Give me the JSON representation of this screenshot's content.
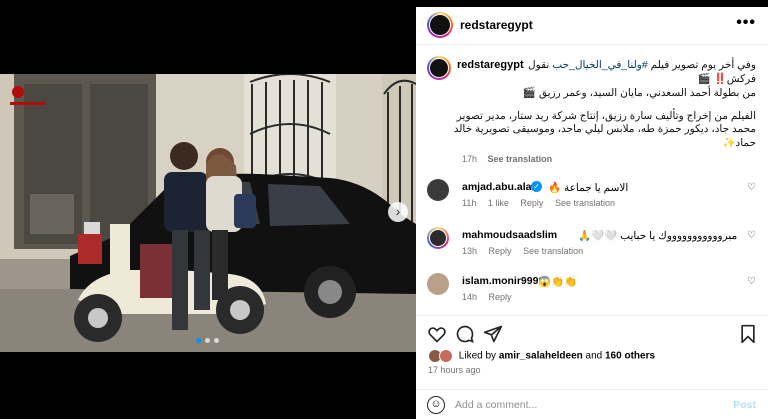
{
  "colors": {
    "accent_link": "#00376b",
    "meta_gray": "#737373",
    "post_disabled": "#b2dffc"
  },
  "post": {
    "username": "redstaregypt",
    "more_icon": "more-horizontal-icon"
  },
  "caption": {
    "username": "redstaregypt",
    "line1_prefix": "وفي أخر يوم تصوير فيلم ",
    "line1_hashtag": "#ولنا_في_الخيال_حب",
    "line1_suffix": " نقول",
    "line2": "فركش‼️ 🎬",
    "line3": "من بطولة أحمد السعدني، مايان السيد، وعمر رزيق 🎬",
    "line4": "الفيلم من إخراج وتأليف سارة رزيق، إنتاج شركة ريد ستار، مدير تصوير",
    "line5": "محمد جاد، ديكور حمزة طه، ملابس ليلي ماجد، وموسيقى تصويرية خالد",
    "line6": "حماد✨",
    "time": "17h",
    "see_translation": "See translation"
  },
  "comments": [
    {
      "user": "amjad.abu.ala",
      "verified": true,
      "text": "الاسم يا جماعة 🔥",
      "time": "11h",
      "likes": "1 like",
      "reply": "Reply",
      "see_translation": "See translation"
    },
    {
      "user": "mahmoudsaadslim",
      "verified": false,
      "text": "مبروووووووووووك يا حبايب 🤍🤍🙏",
      "time": "13h",
      "likes": "",
      "reply": "Reply",
      "see_translation": "See translation"
    },
    {
      "user": "islam.monir9999",
      "verified": false,
      "text": "👏👏😱",
      "time": "14h",
      "likes": "",
      "reply": "Reply",
      "see_translation": ""
    }
  ],
  "actions": {
    "icons": [
      "heart-icon",
      "comment-icon",
      "share-icon",
      "bookmark-icon"
    ]
  },
  "likes": {
    "prefix": "Liked by ",
    "user": "amir_salaheldeen",
    "middle": " and ",
    "others": "160 others"
  },
  "posted_ago": "17 hours ago",
  "add_comment": {
    "placeholder": "Add a comment...",
    "post_label": "Post"
  },
  "carousel": {
    "total_slides": 3,
    "current_slide": 1
  }
}
